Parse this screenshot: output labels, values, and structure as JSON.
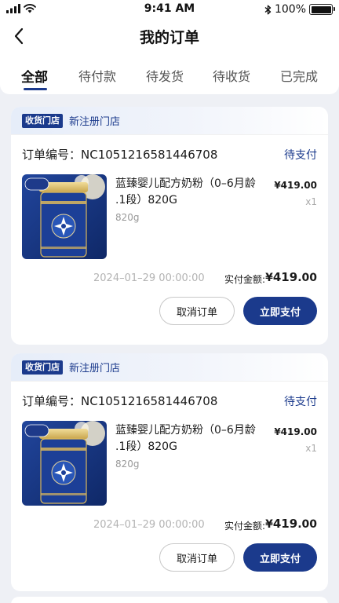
{
  "status_bar": {
    "time": "9:41 AM",
    "battery": "100%"
  },
  "header": {
    "title": "我的订单"
  },
  "tabs": [
    {
      "label": "全部",
      "active": true
    },
    {
      "label": "待付款",
      "active": false
    },
    {
      "label": "待发货",
      "active": false
    },
    {
      "label": "待收货",
      "active": false
    },
    {
      "label": "已完成",
      "active": false
    }
  ],
  "colors": {
    "brand": "#1b3a8c",
    "background": "#eef0f5"
  },
  "orders": [
    {
      "store_badge": "收货门店",
      "store_name": "新注册门店",
      "order_number": "订单编号：NC1051216581446708",
      "status": "待支付",
      "product": {
        "name": "蓝臻婴儿配方奶粉（0–6月龄 .1段）820G",
        "spec": "820g",
        "price_symbol": "¥",
        "price_int": "419",
        "price_dec": ".00",
        "qty": "x1",
        "image_badge": "新国标",
        "image_brand": "Enfinitas 蓝臻"
      },
      "time": "2024–01–29 00:00:00",
      "paid_label": "实付金额:",
      "paid_symbol": "¥",
      "paid_int": "419",
      "paid_dec": ".00",
      "cancel_label": "取消订单",
      "pay_label": "立即支付"
    },
    {
      "store_badge": "收货门店",
      "store_name": "新注册门店",
      "order_number": "订单编号：NC1051216581446708",
      "status": "待支付",
      "product": {
        "name": "蓝臻婴儿配方奶粉（0–6月龄 .1段）820G",
        "spec": "820g",
        "price_symbol": "¥",
        "price_int": "419",
        "price_dec": ".00",
        "qty": "x1",
        "image_badge": "新国标",
        "image_brand": "Enfinitas 蓝臻"
      },
      "time": "2024–01–29 00:00:00",
      "paid_label": "实付金额:",
      "paid_symbol": "¥",
      "paid_int": "419",
      "paid_dec": ".00",
      "cancel_label": "取消订单",
      "pay_label": "立即支付"
    }
  ]
}
